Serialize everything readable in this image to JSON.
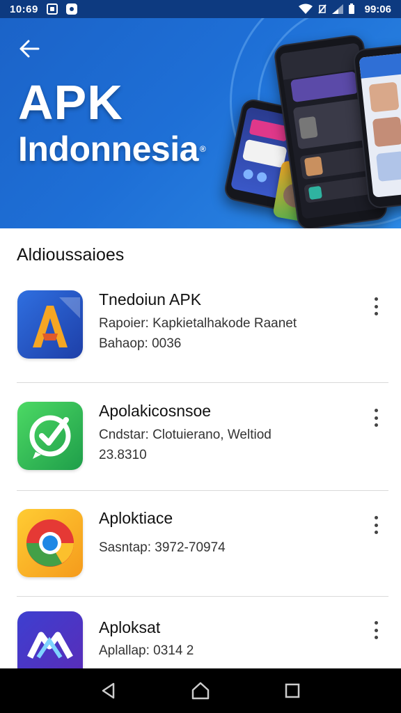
{
  "status_bar": {
    "time_left": "10:69",
    "time_right": "99:06"
  },
  "hero": {
    "title_line1": "APK",
    "title_line2": "Indonnesia",
    "trademark": "®"
  },
  "section": {
    "title": "Aldioussaioes"
  },
  "apps": [
    {
      "name": "Tnedoiun APK",
      "meta1": "Rapoier: Kapkietalhakode Raanet",
      "meta2": "Bahaop: 0036",
      "icon": "apk-a-icon"
    },
    {
      "name": "Apolakicosnsoe",
      "meta1": "Cndstar: Clotuierano, Weltiod",
      "meta2": "23.8310",
      "icon": "check-bubble-icon"
    },
    {
      "name": "Aploktiace",
      "meta1": "Sasntap: 3972-70974",
      "meta2": "",
      "icon": "chrome-icon"
    },
    {
      "name": "Aploksat",
      "meta1": "Aplallap: 0314    2",
      "meta2": "",
      "icon": "nm-logo-icon"
    }
  ],
  "colors": {
    "hero_blue": "#1e6fd6",
    "status_bar": "#0d3a80",
    "nav_bar": "#000000"
  }
}
